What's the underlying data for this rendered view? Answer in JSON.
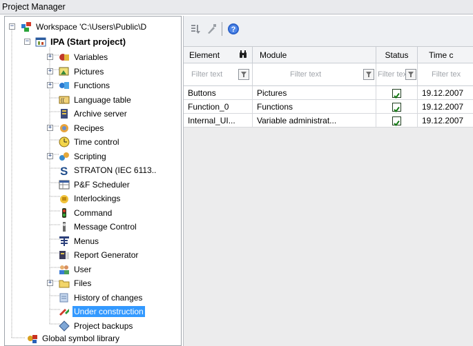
{
  "window": {
    "title": "Project Manager"
  },
  "tree": {
    "workspace": "Workspace 'C:\\Users\\Public\\D",
    "project": "IPA (Start project)",
    "items": [
      {
        "label": "Variables",
        "icon": "variables-icon",
        "expandable": true
      },
      {
        "label": "Pictures",
        "icon": "pictures-icon",
        "expandable": true
      },
      {
        "label": "Functions",
        "icon": "functions-icon",
        "expandable": true
      },
      {
        "label": "Language table",
        "icon": "language-table-icon",
        "expandable": false
      },
      {
        "label": "Archive server",
        "icon": "archive-server-icon",
        "expandable": false
      },
      {
        "label": "Recipes",
        "icon": "recipes-icon",
        "expandable": true
      },
      {
        "label": "Time control",
        "icon": "time-control-icon",
        "expandable": false
      },
      {
        "label": "Scripting",
        "icon": "scripting-icon",
        "expandable": true
      },
      {
        "label": "STRATON (IEC 6113..",
        "icon": "straton-icon",
        "expandable": false
      },
      {
        "label": "P&F Scheduler",
        "icon": "scheduler-icon",
        "expandable": false
      },
      {
        "label": "Interlockings",
        "icon": "interlockings-icon",
        "expandable": false
      },
      {
        "label": "Command",
        "icon": "command-icon",
        "expandable": false
      },
      {
        "label": "Message Control",
        "icon": "message-control-icon",
        "expandable": false
      },
      {
        "label": "Menus",
        "icon": "menus-icon",
        "expandable": false
      },
      {
        "label": "Report Generator",
        "icon": "report-generator-icon",
        "expandable": false
      },
      {
        "label": "User",
        "icon": "user-icon",
        "expandable": false
      },
      {
        "label": "Files",
        "icon": "files-icon",
        "expandable": true
      },
      {
        "label": "History of changes",
        "icon": "history-icon",
        "expandable": false
      },
      {
        "label": "Under construction",
        "icon": "under-construction-icon",
        "expandable": false,
        "selected": true
      },
      {
        "label": "Project backups",
        "icon": "project-backups-icon",
        "expandable": false
      }
    ],
    "global": "Global symbol library"
  },
  "toolbar": {
    "buttons": [
      "sort-icon",
      "properties-icon",
      "help-icon"
    ]
  },
  "grid": {
    "columns": [
      "Element",
      "Module",
      "Status",
      "Time c"
    ],
    "filter_placeholder": "Filter text",
    "filter_placeholder_cut": "Filter tex",
    "rows": [
      {
        "element": "Buttons",
        "module": "Pictures",
        "status": true,
        "time": "19.12.2007"
      },
      {
        "element": "Function_0",
        "module": "Functions",
        "status": true,
        "time": "19.12.2007"
      },
      {
        "element": "Internal_UI...",
        "module": "Variable administrat...",
        "status": true,
        "time": "19.12.2007"
      }
    ]
  },
  "colors": {
    "selection": "#3399ff",
    "panel_bg": "#ececed"
  }
}
